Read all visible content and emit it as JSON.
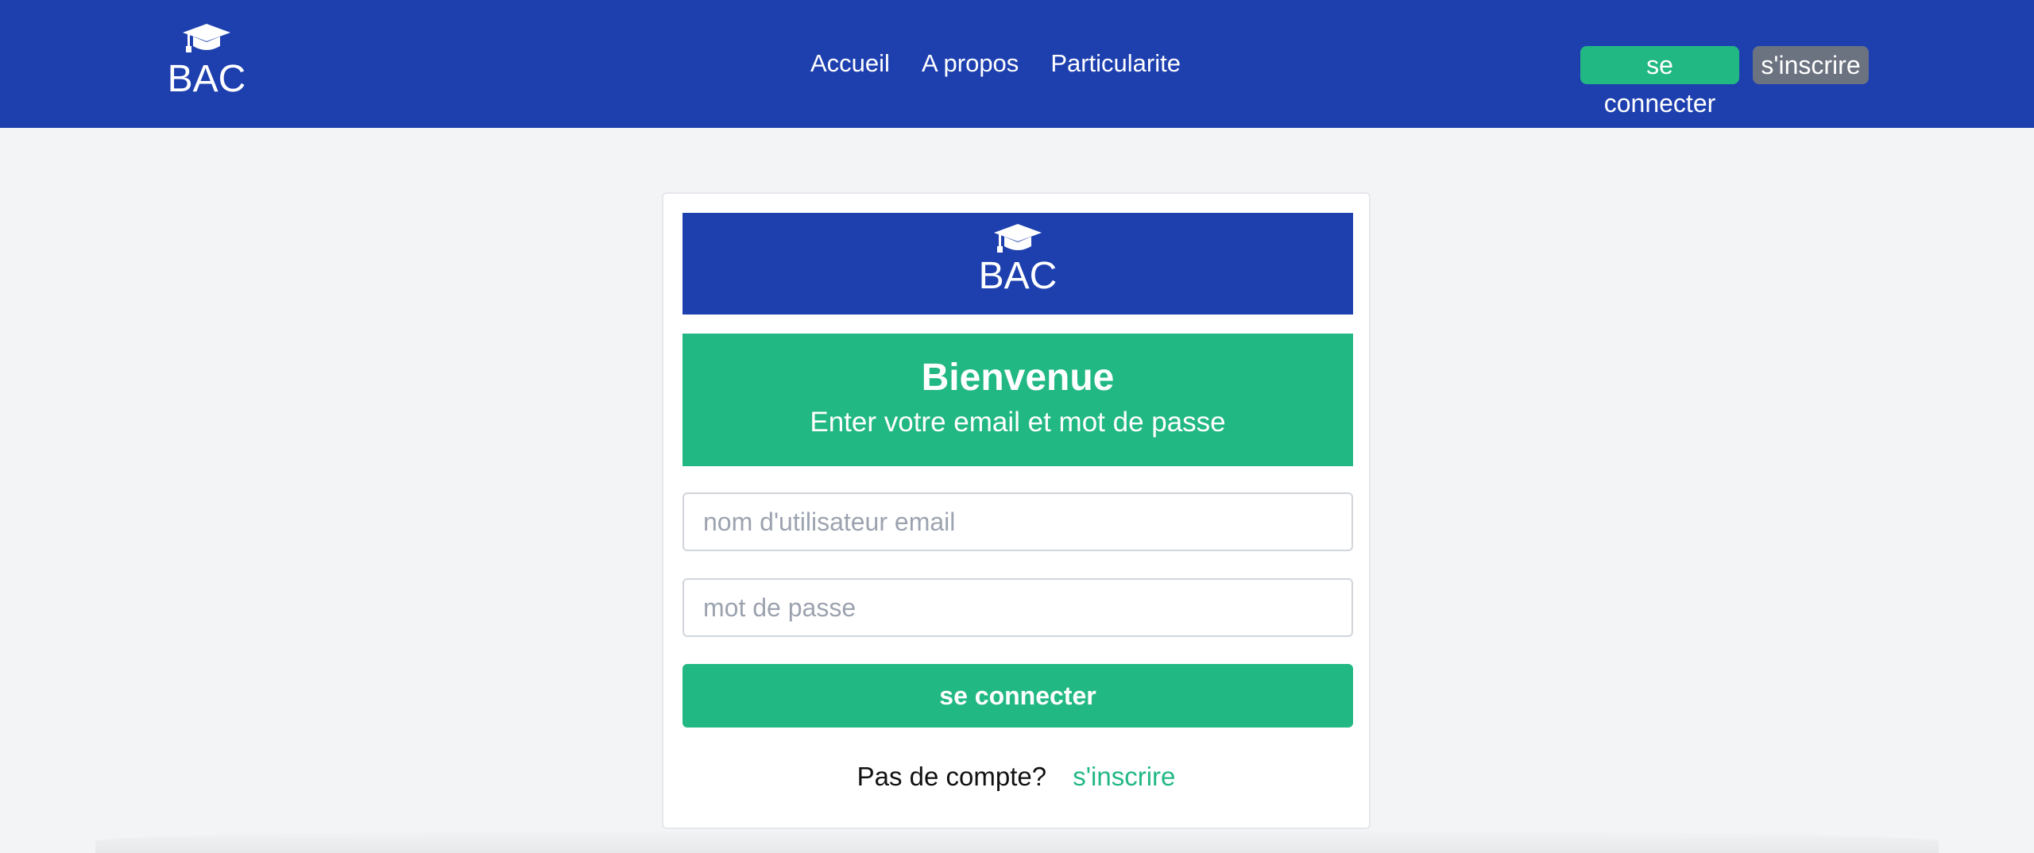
{
  "header": {
    "brand": "BAC",
    "brand_icon": "graduation-cap-icon",
    "nav": [
      "Accueil",
      "A propos",
      "Particularite"
    ],
    "login_label": "se connecter",
    "signup_label": "s'inscrire",
    "colors": {
      "bar": "#1e40af",
      "login": "#22b884",
      "signup": "#6b7280"
    }
  },
  "card": {
    "brand": "BAC",
    "brand_icon": "graduation-cap-icon",
    "welcome_title": "Bienvenue",
    "welcome_subtitle": "Enter votre email et mot de passe",
    "email_placeholder": "nom d'utilisateur email",
    "password_placeholder": "mot de passe",
    "submit_label": "se connecter",
    "no_account_text": "Pas de compte?",
    "signup_link": "s'inscrire",
    "colors": {
      "accent": "#22b884"
    }
  }
}
